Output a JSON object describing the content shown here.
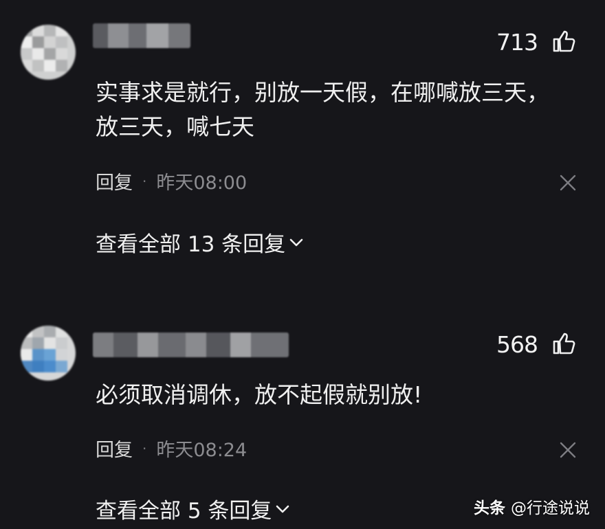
{
  "comments": [
    {
      "likes": "713",
      "text_lines": [
        "实事求是就行，别放一天假，在哪喊放三天，",
        "放三天，喊七天"
      ],
      "reply_label": "回复",
      "separator": "·",
      "time": "昨天08:00",
      "view_all": "查看全部 13 条回复"
    },
    {
      "likes": "568",
      "text_lines": [
        "必须取消调休，放不起假就别放!"
      ],
      "reply_label": "回复",
      "separator": "·",
      "time": "昨天08:24",
      "view_all": "查看全部 5 条回复"
    }
  ],
  "watermark": {
    "brand": "头条",
    "handle": "@行途说说"
  },
  "icons": {
    "like": "thumbs-up-icon",
    "close": "close-icon",
    "expand": "chevron-down-icon"
  },
  "colors": {
    "background": "#16161a",
    "text": "#f0f0f0",
    "meta": "#8c8c90"
  }
}
